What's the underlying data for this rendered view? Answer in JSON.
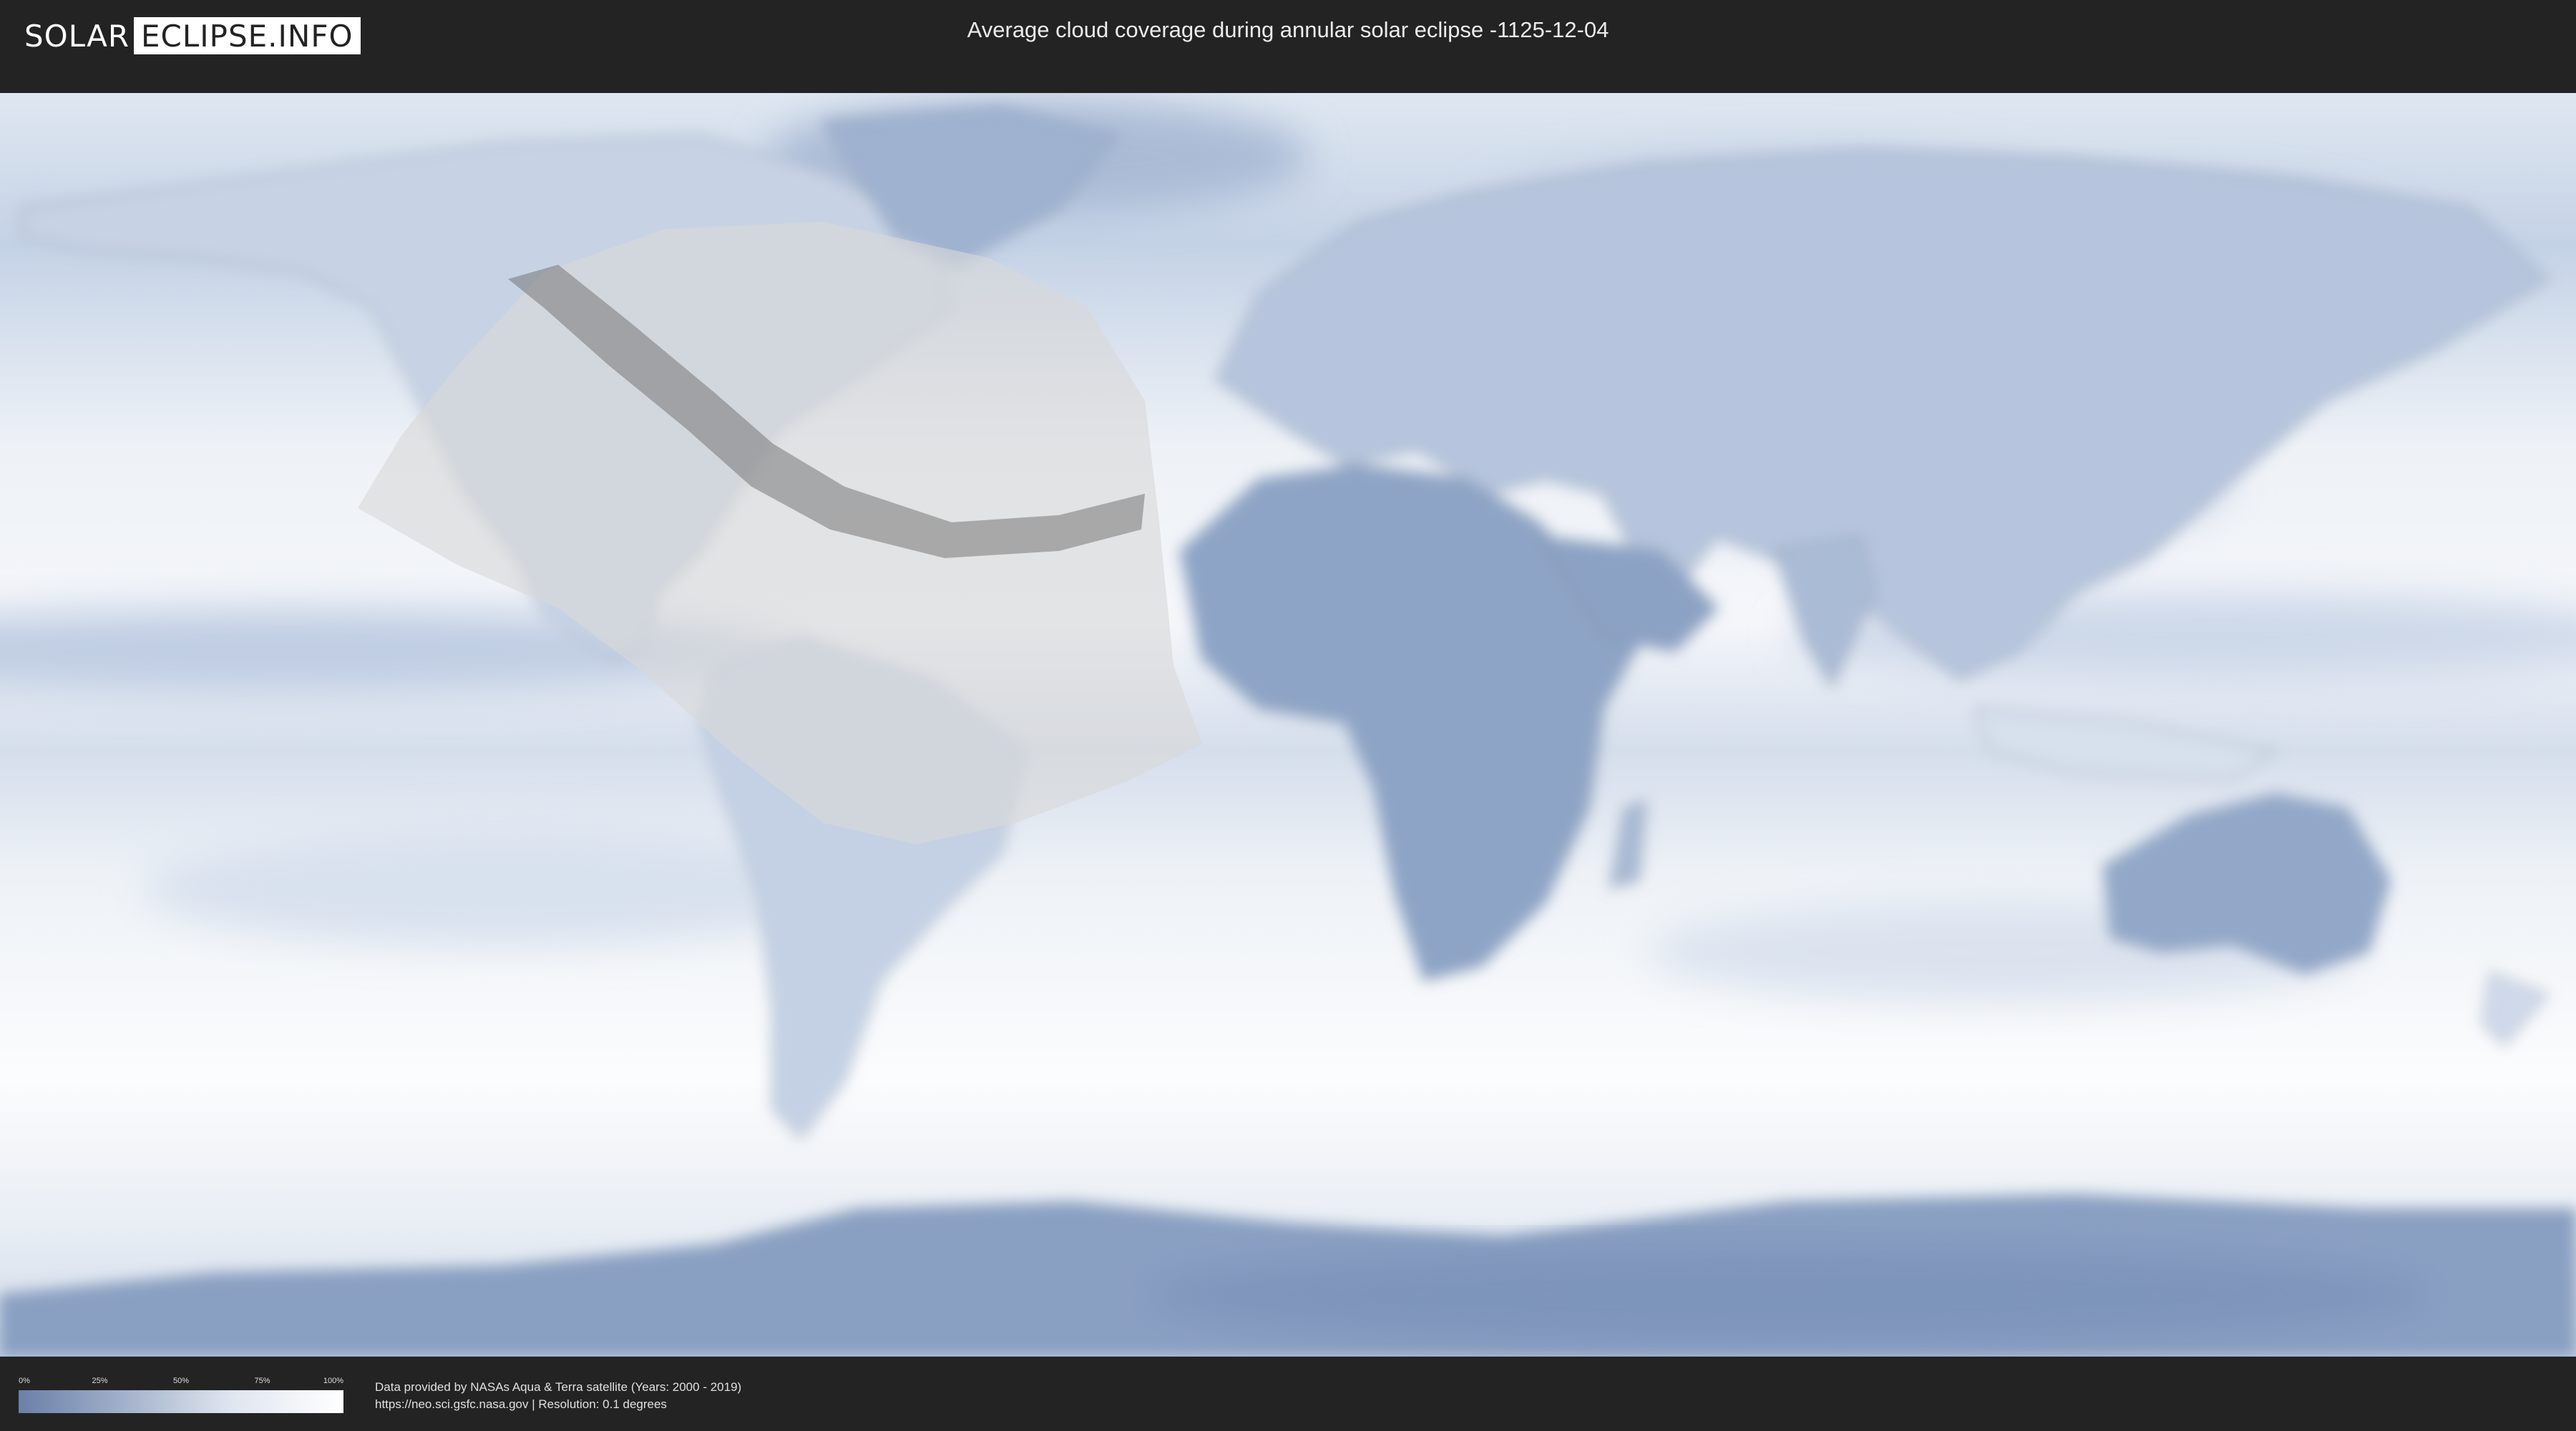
{
  "header": {
    "logo_left": "SOLAR",
    "logo_right": "ECLIPSE.INFO",
    "title": "Average cloud coverage during annular solar eclipse -1125-12-04"
  },
  "map": {
    "colors": {
      "clear_sky": "#6d84ab",
      "full_cloud": "#ffffff",
      "eclipse_region": "#d8d8d8",
      "annular_path": "#6e6e6e",
      "coastline": "#7d8a9c"
    }
  },
  "legend": {
    "labels": [
      "0%",
      "25%",
      "50%",
      "75%",
      "100%"
    ]
  },
  "footer": {
    "credit_line1": "Data provided by NASAs Aqua & Terra satellite (Years: 2000 - 2019)",
    "credit_line2": "https://neo.sci.gsfc.nasa.gov | Resolution: 0.1 degrees"
  }
}
